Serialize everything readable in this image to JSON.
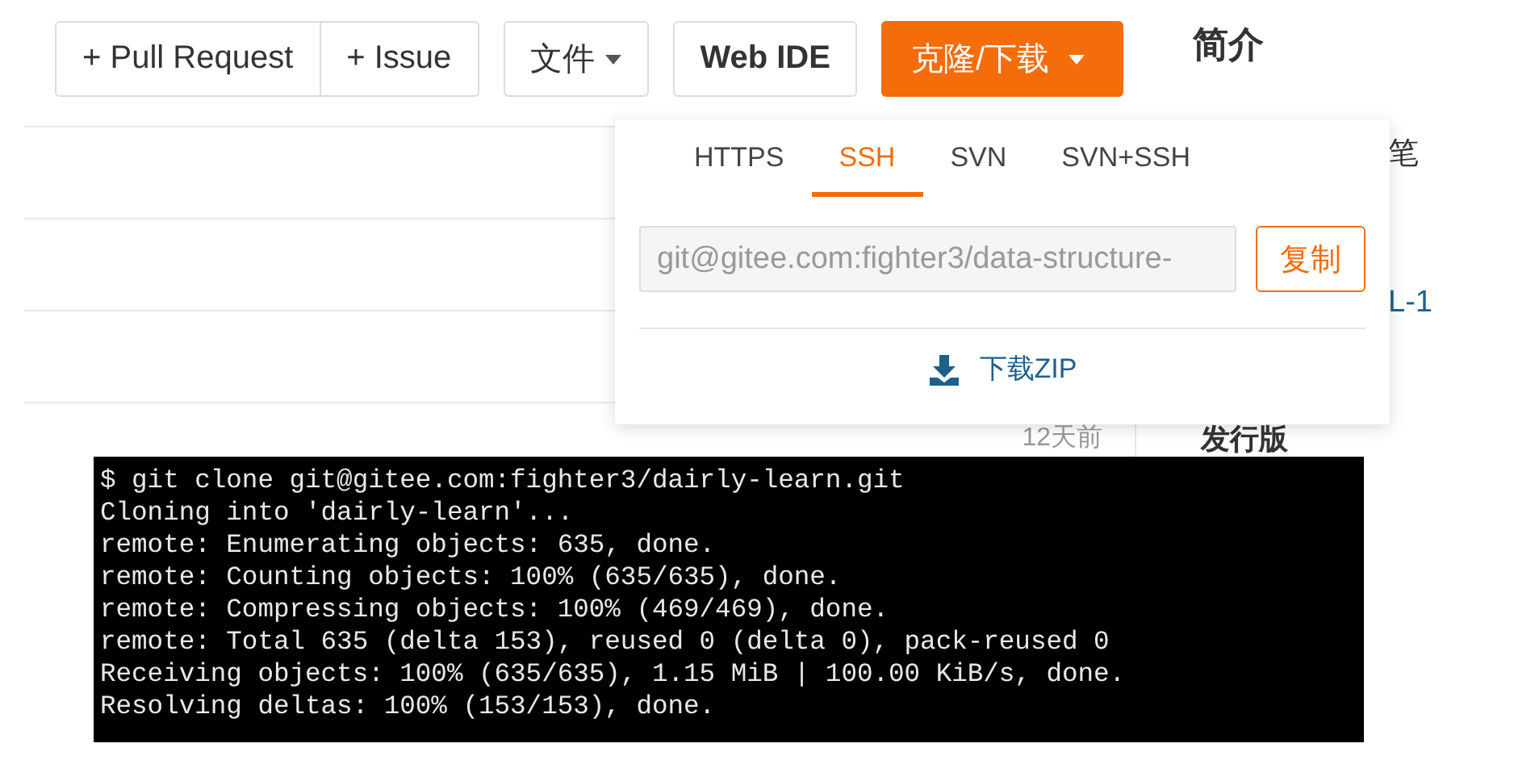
{
  "toolbar": {
    "split_buttons": [
      "+ Pull Request",
      "+ Issue"
    ],
    "files_menu": "文件",
    "web_ide": "Web IDE",
    "clone_button": "克隆/下载",
    "intro_heading": "简介"
  },
  "clone_panel": {
    "tabs": [
      {
        "label": "HTTPS",
        "selected": false
      },
      {
        "label": "SSH",
        "selected": true
      },
      {
        "label": "SVN",
        "selected": false
      },
      {
        "label": "SVN+SSH",
        "selected": false
      }
    ],
    "url": "git@gitee.com:fighter3/data-structure-",
    "copy_button": "复制",
    "download_zip": "下载ZIP"
  },
  "background": {
    "side_text_1": "笔",
    "side_text_2": "L-1",
    "row_time": "12天前",
    "sidebar_heading": "发行版"
  },
  "terminal": {
    "lines": [
      "$ git clone git@gitee.com:fighter3/dairly-learn.git",
      "Cloning into 'dairly-learn'...",
      "remote: Enumerating objects: 635, done.",
      "remote: Counting objects: 100% (635/635), done.",
      "remote: Compressing objects: 100% (469/469), done.",
      "remote: Total 635 (delta 153), reused 0 (delta 0), pack-reused 0",
      "Receiving objects: 100% (635/635), 1.15 MiB | 100.00 KiB/s, done.",
      "Resolving deltas: 100% (153/153), done."
    ]
  }
}
